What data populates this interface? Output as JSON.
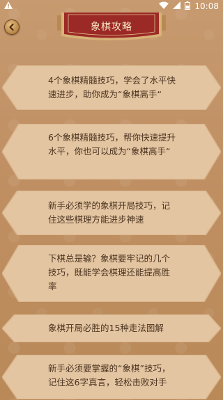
{
  "status_bar": {
    "time": "10:08",
    "left_icon": "warning-icon",
    "right_icons": [
      "wifi-icon",
      "signal-icon",
      "battery-icon"
    ]
  },
  "header": {
    "title": "象棋攻略",
    "back_icon": "back-arrow-icon"
  },
  "articles": [
    {
      "title": "4个象棋精髓技巧，学会了水平快速进步，助你成为“象棋高手“"
    },
    {
      "title": "6个象棋精髓技巧，帮你快速提升水平，你也可以成为“象棋高手“"
    },
    {
      "title": "新手必须学的象棋开局技巧，记住这些棋理方能进步神速"
    },
    {
      "title": "下棋总是输？象棋要牢记的几个技巧，既能学会棋理还能提高胜率"
    },
    {
      "title": "象棋开局必胜的15种走法图解"
    },
    {
      "title": "新手必须要掌握的“象棋”技巧，记住这6字真言，轻松击败对手"
    }
  ],
  "colors": {
    "background": "#c09064",
    "banner_red": "#9b2a26",
    "text": "#4a3421"
  }
}
